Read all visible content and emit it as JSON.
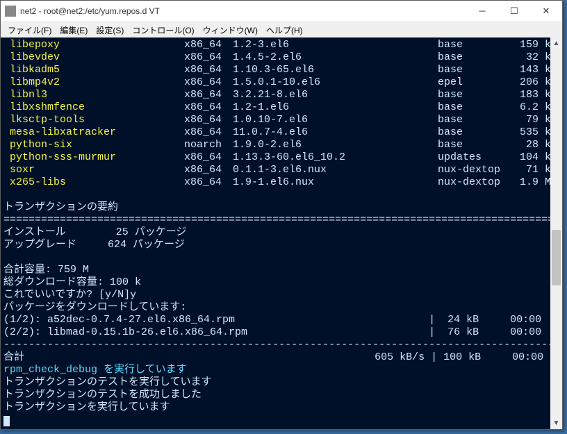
{
  "window": {
    "title": "net2 - root@net2:/etc/yum.repos.d VT"
  },
  "menubar": [
    "ファイル(F)",
    "編集(E)",
    "設定(S)",
    "コントロール(O)",
    "ウィンドウ(W)",
    "ヘルプ(H)"
  ],
  "packages": [
    {
      "name": " libepoxy",
      "arch": "x86_64",
      "ver": "1.2-3.el6",
      "repo": "base",
      "size": "159 k"
    },
    {
      "name": " libevdev",
      "arch": "x86_64",
      "ver": "1.4.5-2.el6",
      "repo": "base",
      "size": "32 k"
    },
    {
      "name": " libkadm5",
      "arch": "x86_64",
      "ver": "1.10.3-65.el6",
      "repo": "base",
      "size": "143 k"
    },
    {
      "name": " libmp4v2",
      "arch": "x86_64",
      "ver": "1.5.0.1-10.el6",
      "repo": "epel",
      "size": "206 k"
    },
    {
      "name": " libnl3",
      "arch": "x86_64",
      "ver": "3.2.21-8.el6",
      "repo": "base",
      "size": "183 k"
    },
    {
      "name": " libxshmfence",
      "arch": "x86_64",
      "ver": "1.2-1.el6",
      "repo": "base",
      "size": "6.2 k"
    },
    {
      "name": " lksctp-tools",
      "arch": "x86_64",
      "ver": "1.0.10-7.el6",
      "repo": "base",
      "size": "79 k"
    },
    {
      "name": " mesa-libxatracker",
      "arch": "x86_64",
      "ver": "11.0.7-4.el6",
      "repo": "base",
      "size": "535 k"
    },
    {
      "name": " python-six",
      "arch": "noarch",
      "ver": "1.9.0-2.el6",
      "repo": "base",
      "size": "28 k"
    },
    {
      "name": " python-sss-murmur",
      "arch": "x86_64",
      "ver": "1.13.3-60.el6_10.2",
      "repo": "updates",
      "size": "104 k"
    },
    {
      "name": " soxr",
      "arch": "x86_64",
      "ver": "0.1.1-3.el6.nux",
      "repo": "nux-dextop",
      "size": "71 k"
    },
    {
      "name": " x265-libs",
      "arch": "x86_64",
      "ver": "1.9-1.el6.nux",
      "repo": "nux-dextop",
      "size": "1.9 M"
    }
  ],
  "summary_title": "トランザクションの要約",
  "sep": "================================================================================================",
  "install_label": "インストール        25 パッケージ",
  "upgrade_label": "アップグレード     624 パッケージ",
  "total_size": "合計容量: 759 M",
  "total_dl": "総ダウンロード容量: 100 k",
  "confirm": "これでいいですか? [y/N]y",
  "dl_header": "パッケージをダウンロードしています:",
  "dl1_left": "(1/2): a52dec-0.7.4-27.el6.x86_64.rpm",
  "dl1_right": "|  24 kB     00:00",
  "dl2_left": "(2/2): libmad-0.15.1b-26.el6.x86_64.rpm",
  "dl2_right": "|  76 kB     00:00",
  "dash": "------------------------------------------------------------------------------------------------",
  "total_left": "合計",
  "total_right": "605 kB/s | 100 kB     00:00",
  "rpm_check": "rpm_check_debug を実行しています",
  "test_run": "トランザクションのテストを実行しています",
  "test_ok": "トランザクションのテストを成功しました",
  "running": "トランザクションを実行しています"
}
